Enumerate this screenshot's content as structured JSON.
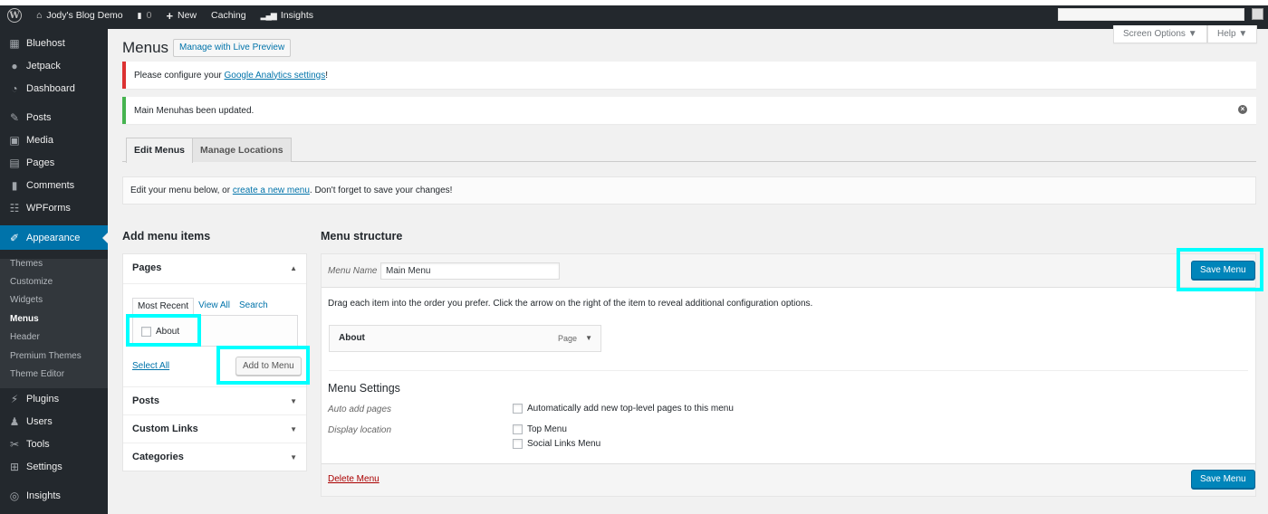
{
  "admin_bar": {
    "site_name": "Jody's Blog Demo",
    "comments_count": "0",
    "new_label": "New",
    "caching_label": "Caching",
    "insights_label": "Insights"
  },
  "sidebar": {
    "items": [
      {
        "label": "Bluehost",
        "icon": "grid-icon"
      },
      {
        "label": "Jetpack",
        "icon": "jetpack-icon"
      },
      {
        "label": "Dashboard",
        "icon": "dashboard-icon"
      },
      {
        "label": "Posts",
        "icon": "pin-icon"
      },
      {
        "label": "Media",
        "icon": "media-icon"
      },
      {
        "label": "Pages",
        "icon": "pages-icon"
      },
      {
        "label": "Comments",
        "icon": "comment-icon"
      },
      {
        "label": "WPForms",
        "icon": "form-icon"
      },
      {
        "label": "Appearance",
        "icon": "brush-icon"
      },
      {
        "label": "Plugins",
        "icon": "plug-icon"
      },
      {
        "label": "Users",
        "icon": "user-icon"
      },
      {
        "label": "Tools",
        "icon": "wrench-icon"
      },
      {
        "label": "Settings",
        "icon": "settings-icon"
      },
      {
        "label": "Insights",
        "icon": "insights-icon"
      }
    ],
    "appearance_sub": [
      "Themes",
      "Customize",
      "Widgets",
      "Menus",
      "Header",
      "Premium Themes",
      "Theme Editor"
    ]
  },
  "screen_options_label": "Screen Options ▼",
  "help_label": "Help ▼",
  "page": {
    "title": "Menus",
    "live_preview_label": "Manage with Live Preview"
  },
  "notices": {
    "analytics_prefix": "Please configure your ",
    "analytics_link": "Google Analytics settings",
    "analytics_suffix": "!",
    "updated_bold": "Main Menu",
    "updated_text": " has been updated."
  },
  "tabs": {
    "edit": "Edit Menus",
    "locations": "Manage Locations"
  },
  "manage_bar": {
    "prefix": "Edit your menu below, or ",
    "link": "create a new menu",
    "suffix": ". Don't forget to save your changes!"
  },
  "add_items": {
    "heading": "Add menu items",
    "pages_title": "Pages",
    "tab_recent": "Most Recent",
    "tab_view_all": "View All",
    "tab_search": "Search",
    "page_item": "About",
    "select_all": "Select All",
    "add_button": "Add to Menu",
    "posts_title": "Posts",
    "custom_links_title": "Custom Links",
    "categories_title": "Categories"
  },
  "structure": {
    "heading": "Menu structure",
    "menu_name_label": "Menu Name",
    "menu_name_value": "Main Menu",
    "save_label": "Save Menu",
    "instructions": "Drag each item into the order you prefer. Click the arrow on the right of the item to reveal additional configuration options.",
    "item_title": "About",
    "item_type": "Page",
    "settings_heading": "Menu Settings",
    "auto_add_label": "Auto add pages",
    "auto_add_option": "Automatically add new top-level pages to this menu",
    "display_location_label": "Display location",
    "location_top": "Top Menu",
    "location_social": "Social Links Menu",
    "delete_label": "Delete Menu"
  },
  "colors": {
    "admin_dark": "#23282d",
    "accent_blue": "#0073aa",
    "primary_button": "#0085ba",
    "highlight": "#00ffff",
    "error_border": "#dc3232",
    "success_border": "#46b450"
  }
}
